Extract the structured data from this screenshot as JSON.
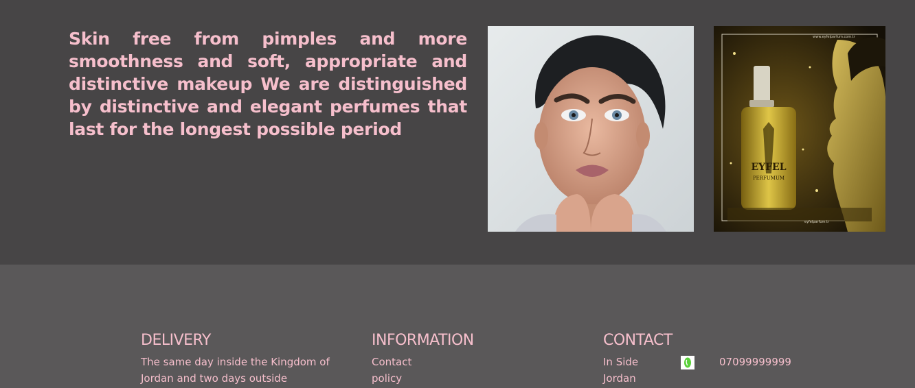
{
  "hero": {
    "text": "Skin free from pimples and more smoothness and soft, appropriate and distinctive makeup We are distinguished by distinctive and elegant perfumes that last for the longest possible period",
    "perfume_brand": "EYFEL",
    "perfume_sub": "PERFUMUM",
    "perfume_url_top": "www.eyfelparfum.com.tr",
    "perfume_url_bottom": "eyfelparfum.tr"
  },
  "footer": {
    "delivery": {
      "heading": "DELIVERY",
      "text": "The same day inside the Kingdom of Jordan and two days outside"
    },
    "information": {
      "heading": "INFORMATION",
      "links": [
        "Contact",
        "policy"
      ]
    },
    "contact": {
      "heading": "CONTACT",
      "location_line1": "In Side",
      "location_line2": "Jordan",
      "phone_icon": "whatsapp-icon",
      "phone": "07099999999"
    }
  },
  "colors": {
    "hero_bg": "#474546",
    "footer_bg": "#5a5859",
    "accent_text": "#f6bfcc",
    "icon_green": "#5bd13b"
  }
}
